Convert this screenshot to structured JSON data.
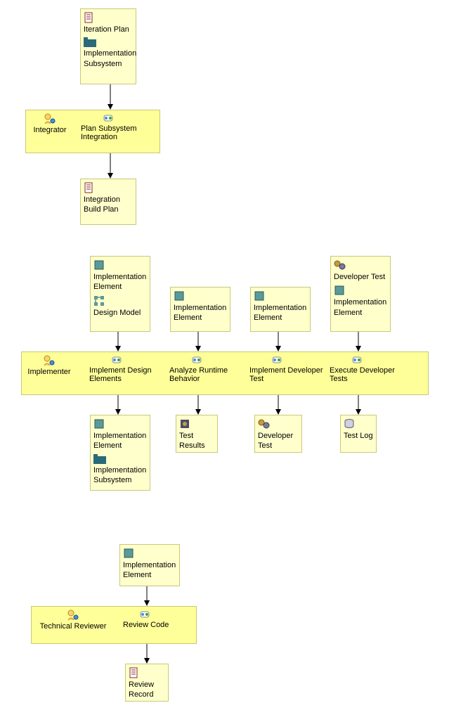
{
  "section1": {
    "inputs": {
      "iteration_plan": "Iteration Plan",
      "impl_subsystem": "Implementation Subsystem"
    },
    "role": "Integrator",
    "activity": "Plan Subsystem Integration",
    "output": "Integration Build Plan"
  },
  "section2": {
    "role": "Implementer",
    "col1": {
      "in1": "Implementation Element",
      "in2": "Design Model",
      "activity": "Implement Design Elements",
      "out1": "Implementation Element",
      "out2": "Implementation Subsystem"
    },
    "col2": {
      "in": "Implementation Element",
      "activity": "Analyze Runtime Behavior",
      "out": "Test Results"
    },
    "col3": {
      "in": "Implementation Element",
      "activity": "Implement Developer Test",
      "out": "Developer Test"
    },
    "col4": {
      "in1": "Developer Test",
      "in2": "Implementation Element",
      "activity": "Execute Developer Tests",
      "out": "Test Log"
    }
  },
  "section3": {
    "in": "Implementation Element",
    "role": "Technical Reviewer",
    "activity": "Review Code",
    "out": "Review Record"
  }
}
